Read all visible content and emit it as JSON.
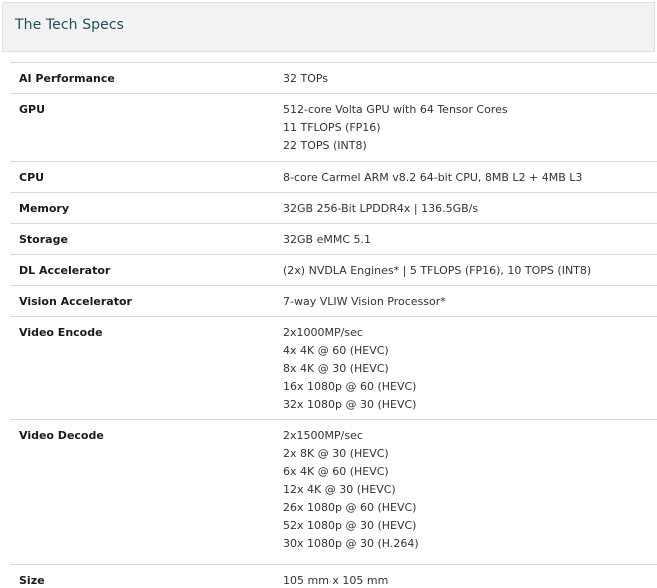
{
  "header": {
    "title": "The Tech Specs"
  },
  "specs": [
    {
      "label": "AI Performance",
      "values": [
        "32 TOPs"
      ]
    },
    {
      "label": "GPU",
      "values": [
        "512-core Volta GPU with 64 Tensor Cores",
        "11 TFLOPS (FP16)",
        "22 TOPS (INT8)"
      ]
    },
    {
      "label": "CPU",
      "values": [
        "8-core Carmel ARM v8.2 64-bit CPU, 8MB L2 + 4MB L3"
      ]
    },
    {
      "label": "Memory",
      "values": [
        "32GB 256-Bit LPDDR4x | 136.5GB/s"
      ]
    },
    {
      "label": "Storage",
      "values": [
        "32GB eMMC 5.1"
      ]
    },
    {
      "label": "DL Accelerator",
      "values": [
        "(2x) NVDLA Engines* | 5 TFLOPS (FP16), 10 TOPS (INT8)"
      ]
    },
    {
      "label": "Vision Accelerator",
      "values": [
        "7-way VLIW Vision Processor*"
      ]
    },
    {
      "label": "Video Encode",
      "values": [
        "2x1000MP/sec",
        "4x 4K @ 60 (HEVC)",
        "8x 4K @ 30 (HEVC)",
        "16x 1080p @ 60 (HEVC)",
        "32x 1080p @ 30 (HEVC)"
      ]
    },
    {
      "label": "Video Decode",
      "values": [
        "2x1500MP/sec",
        "2x 8K @ 30 (HEVC)",
        "6x 4K @ 60 (HEVC)",
        "12x 4K @ 30 (HEVC)",
        "26x 1080p @ 60 (HEVC)",
        "52x 1080p @ 30 (HEVC)",
        "30x 1080p @ 30 (H.264)"
      ]
    },
    {
      "label": "Size",
      "values": [
        "105 mm x 105 mm"
      ]
    }
  ]
}
